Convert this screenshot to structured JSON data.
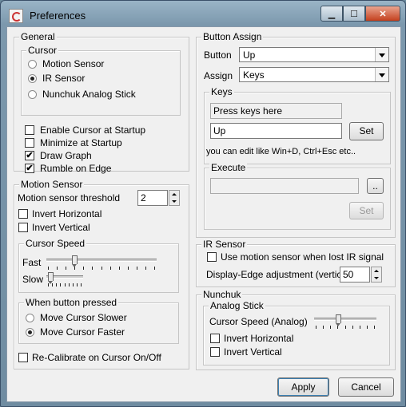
{
  "window": {
    "title": "Preferences"
  },
  "general": {
    "legend": "General",
    "cursor": {
      "legend": "Cursor",
      "options": [
        "Motion Sensor",
        "IR Sensor",
        "Nunchuk Analog Stick"
      ],
      "selected": 1
    },
    "checks": [
      {
        "label": "Enable Cursor at Startup",
        "checked": false
      },
      {
        "label": "Minimize at Startup",
        "checked": false
      },
      {
        "label": "Draw Graph",
        "checked": true
      },
      {
        "label": "Rumble on Edge",
        "checked": true
      }
    ]
  },
  "motion": {
    "legend": "Motion Sensor",
    "threshold_label": "Motion sensor threshold",
    "threshold_value": "2",
    "invert_h": "Invert Horizontal",
    "invert_v": "Invert Vertical",
    "speed": {
      "legend": "Cursor Speed",
      "fast_label": "Fast",
      "slow_label": "Slow",
      "fast_value": 0.24,
      "slow_value": 0.05
    },
    "pressed": {
      "legend": "When button pressed",
      "options": [
        "Move Cursor Slower",
        "Move Cursor Faster"
      ],
      "selected": 1
    },
    "recalibrate": "Re-Calibrate on Cursor On/Off"
  },
  "assign": {
    "legend": "Button Assign",
    "button_label": "Button",
    "button_value": "Up",
    "assign_label": "Assign",
    "assign_value": "Keys",
    "keys": {
      "legend": "Keys",
      "prompt": "Press keys here",
      "value": "Up",
      "set": "Set",
      "hint": "you can edit like Win+D, Ctrl+Esc etc.."
    },
    "execute": {
      "legend": "Execute",
      "browse": "..",
      "set": "Set"
    }
  },
  "ir": {
    "legend": "IR Sensor",
    "lost_label": "Use motion sensor when lost IR signal",
    "edge_label": "Display-Edge adjustment (vertical)",
    "edge_value": "50"
  },
  "nunchuk": {
    "legend": "Nunchuk",
    "analog": {
      "legend": "Analog Stick",
      "speed_label": "Cursor Speed (Analog)",
      "speed_value": 0.38,
      "invert_h": "Invert Horizontal",
      "invert_v": "Invert Vertical"
    }
  },
  "footer": {
    "apply": "Apply",
    "cancel": "Cancel"
  }
}
